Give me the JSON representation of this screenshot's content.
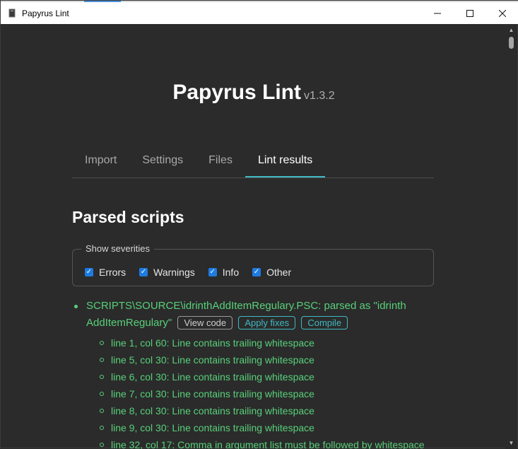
{
  "window": {
    "title": "Papyrus Lint",
    "controls": {
      "minimize": "─",
      "maximize": "☐",
      "close": "✕"
    }
  },
  "header": {
    "app_name": "Papyrus Lint",
    "version": "v1.3.2"
  },
  "tabs": [
    {
      "label": "Import",
      "active": false
    },
    {
      "label": "Settings",
      "active": false
    },
    {
      "label": "Files",
      "active": false
    },
    {
      "label": "Lint results",
      "active": true
    }
  ],
  "section": {
    "title": "Parsed scripts"
  },
  "severities": {
    "legend": "Show severities",
    "options": [
      {
        "label": "Errors",
        "checked": true
      },
      {
        "label": "Warnings",
        "checked": true
      },
      {
        "label": "Info",
        "checked": true
      },
      {
        "label": "Other",
        "checked": true
      }
    ]
  },
  "result": {
    "file_text": "SCRIPTS\\SOURCE\\idrinthAddItemRegulary.PSC: parsed as \"idrinth AddItemRegulary\"",
    "buttons": {
      "view_code": "View code",
      "apply_fixes": "Apply fixes",
      "compile": "Compile"
    },
    "issues": [
      "line 1, col 60: Line contains trailing whitespace",
      "line 5, col 30: Line contains trailing whitespace",
      "line 6, col 30: Line contains trailing whitespace",
      "line 7, col 30: Line contains trailing whitespace",
      "line 8, col 30: Line contains trailing whitespace",
      "line 9, col 30: Line contains trailing whitespace",
      "line 32, col 17: Comma in argument list must be followed by whitespace"
    ]
  },
  "colors": {
    "background": "#2b2b2b",
    "accent": "#3fb9c4",
    "success_text": "#58d07a",
    "checkbox": "#1e7be0"
  }
}
